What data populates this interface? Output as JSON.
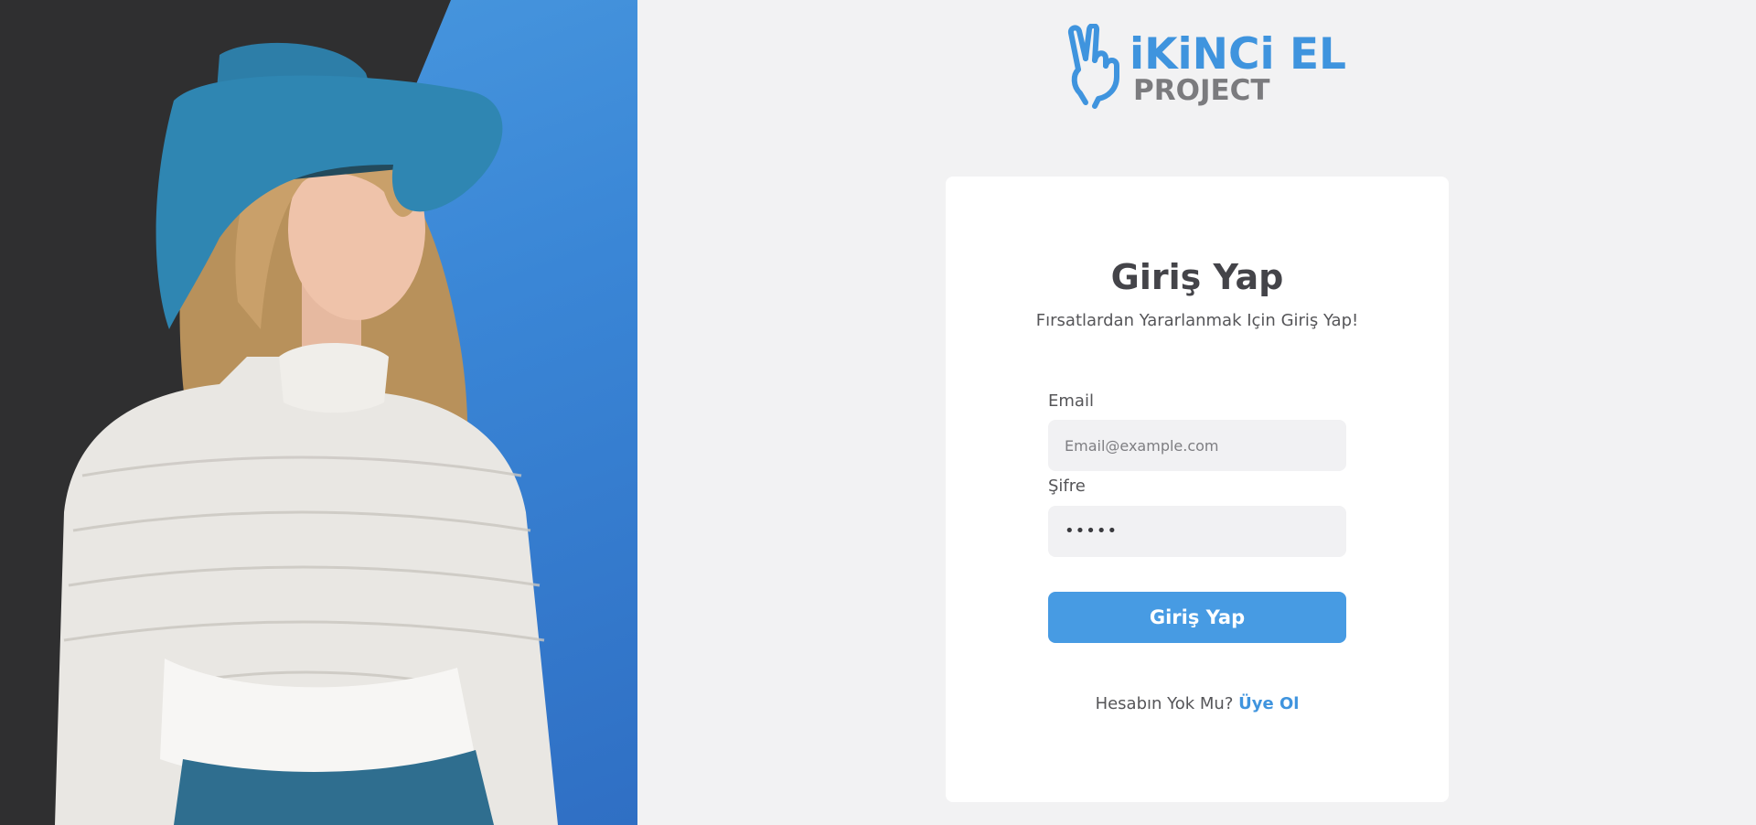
{
  "brand": {
    "title": "iKiNCi EL",
    "subtitle": "PROJECT",
    "accent_color": "#3f94de",
    "subtitle_color": "#7b7b7e",
    "logo_icon": "peace-hand-icon"
  },
  "hero": {
    "image": "woman-in-blue-hat-photo",
    "background_colors": [
      "#2f2f30",
      "#3a86d6"
    ]
  },
  "login": {
    "title": "Giriş Yap",
    "subtitle": "Fırsatlardan Yararlanmak Için Giriş Yap!",
    "email_label": "Email",
    "email_placeholder": "Email@example.com",
    "password_label": "Şifre",
    "password_value": "•••••",
    "submit_label": "Giriş Yap",
    "signup_prompt": "Hesabın Yok Mu?",
    "signup_link": "Üye Ol",
    "button_color": "#479be3"
  }
}
